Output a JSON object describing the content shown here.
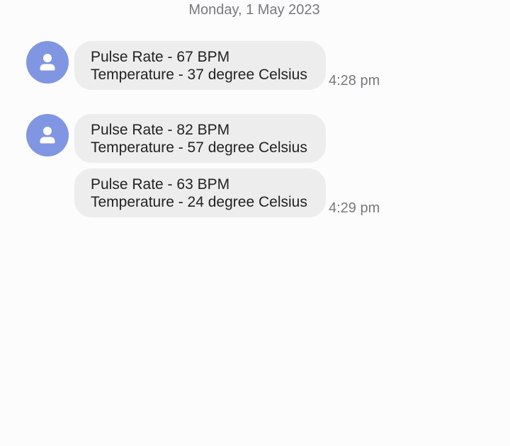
{
  "date_header": "Monday, 1 May 2023",
  "icons": {
    "avatar": "contact-person-icon"
  },
  "colors": {
    "avatar_bg": "#8196e2",
    "bubble_bg": "#ededed",
    "timestamp": "#77797d"
  },
  "messages": [
    {
      "line1": "Pulse Rate - 67 BPM",
      "line2": "Temperature - 37 degree Celsius",
      "time": "4:28 pm"
    },
    {
      "line1": "Pulse Rate - 82 BPM",
      "line2": "Temperature - 57 degree Celsius"
    },
    {
      "line1": "Pulse Rate - 63 BPM",
      "line2": "Temperature - 24 degree Celsius",
      "time": "4:29 pm"
    }
  ]
}
